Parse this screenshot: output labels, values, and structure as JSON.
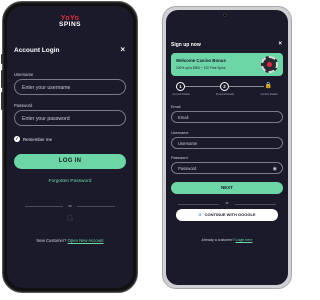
{
  "login_phone": {
    "logo_line1": "YoYo",
    "logo_line2": "SPINS",
    "title": "Account Login",
    "close": "×",
    "username_label": "Username",
    "username_placeholder": "Enter your username",
    "password_label": "Password",
    "password_placeholder": "Enter your password",
    "remember_label": "Remember me",
    "login_button": "LOG IN",
    "forgot_link": "Forgotten Password",
    "or_text": "or",
    "google_glyph": "G",
    "new_customer_text": "New Customer?",
    "open_account_link": "Open New Account"
  },
  "signup_phone": {
    "title": "Sign up now",
    "close": "×",
    "bonus_title": "Welcome Casino Bonus",
    "bonus_subtitle": "100% up to $500 + 100 Free Spins",
    "steps": [
      {
        "number": "1",
        "label": "Account Details"
      },
      {
        "number": "2",
        "label": "Personal Details"
      },
      {
        "number": "",
        "label": "Confirm Details"
      }
    ],
    "email_label": "Email",
    "email_placeholder": "Email",
    "username_label": "Username",
    "username_placeholder": "Username",
    "password_label": "Password",
    "password_placeholder": "Password",
    "next_button": "NEXT",
    "or_text": "or",
    "google_button": "CONTINUE WITH GOOGLE",
    "google_glyph": "G",
    "already_text": "Already a customer?",
    "login_link": "Login here"
  },
  "colors": {
    "background": "#1a1a2a",
    "accent": "#6dd6a6",
    "brand_red": "#e4283c"
  }
}
